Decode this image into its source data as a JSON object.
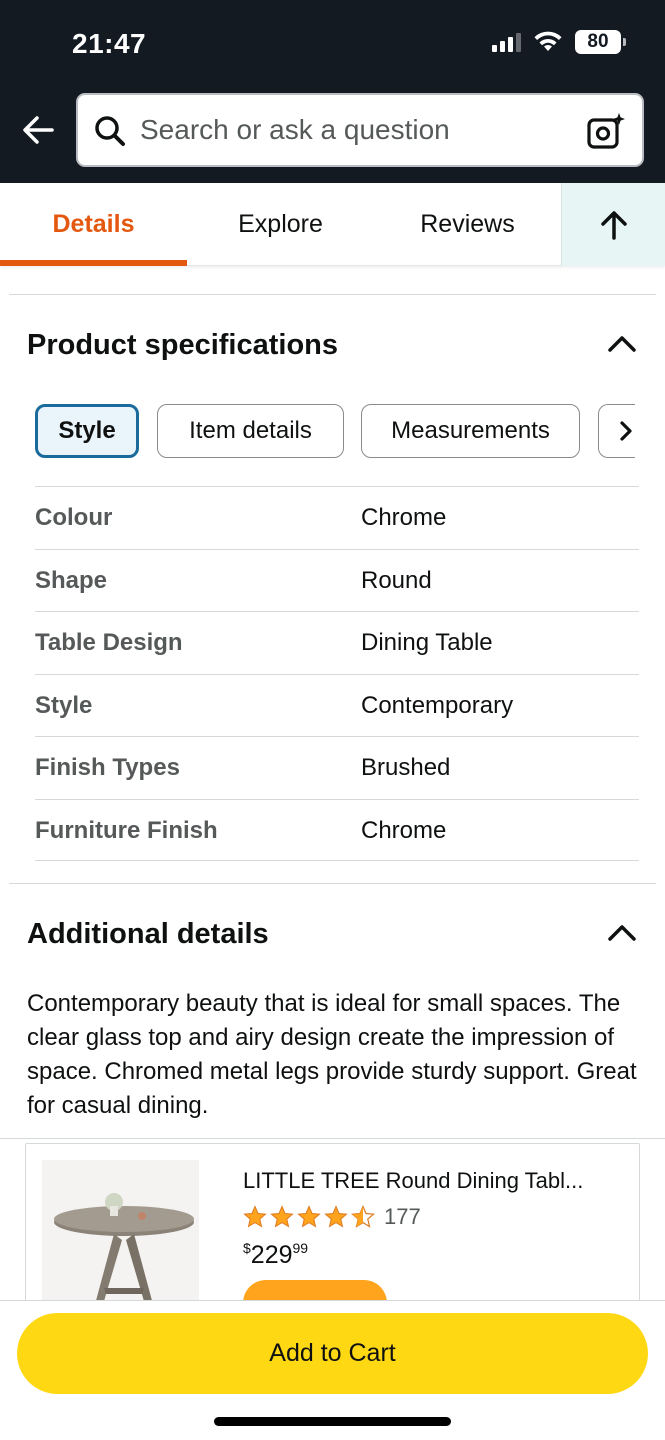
{
  "status_bar": {
    "time": "21:47",
    "battery": "80"
  },
  "search": {
    "placeholder": "Search or ask a question"
  },
  "tabs": [
    {
      "label": "Details"
    },
    {
      "label": "Explore"
    },
    {
      "label": "Reviews"
    }
  ],
  "product_specifications": {
    "title": "Product specifications",
    "pills": [
      {
        "label": "Style"
      },
      {
        "label": "Item details"
      },
      {
        "label": "Measurements"
      }
    ],
    "rows": [
      {
        "key": "Colour",
        "value": "Chrome"
      },
      {
        "key": "Shape",
        "value": "Round"
      },
      {
        "key": "Table Design",
        "value": "Dining Table"
      },
      {
        "key": "Style",
        "value": "Contemporary"
      },
      {
        "key": "Finish Types",
        "value": "Brushed"
      },
      {
        "key": "Furniture Finish",
        "value": "Chrome"
      }
    ]
  },
  "additional_details": {
    "title": "Additional details",
    "text": "Contemporary beauty that is ideal for small spaces. The clear glass top and airy design create the impression of space. Chromed metal legs provide sturdy support. Great for casual dining."
  },
  "product_card": {
    "title": "LITTLE TREE Round Dining Tabl...",
    "rating": 4.5,
    "review_count": "177",
    "price_symbol": "$",
    "price_whole": "229",
    "price_cents": "99"
  },
  "bottom_bar": {
    "add_to_cart_label": "Add to Cart"
  },
  "colors": {
    "header_bg": "#131a22",
    "tab_active": "#e4570f",
    "pill_selected_border": "#1a6b9c",
    "add_to_cart": "#ffd814",
    "star": "#ffa41c"
  }
}
